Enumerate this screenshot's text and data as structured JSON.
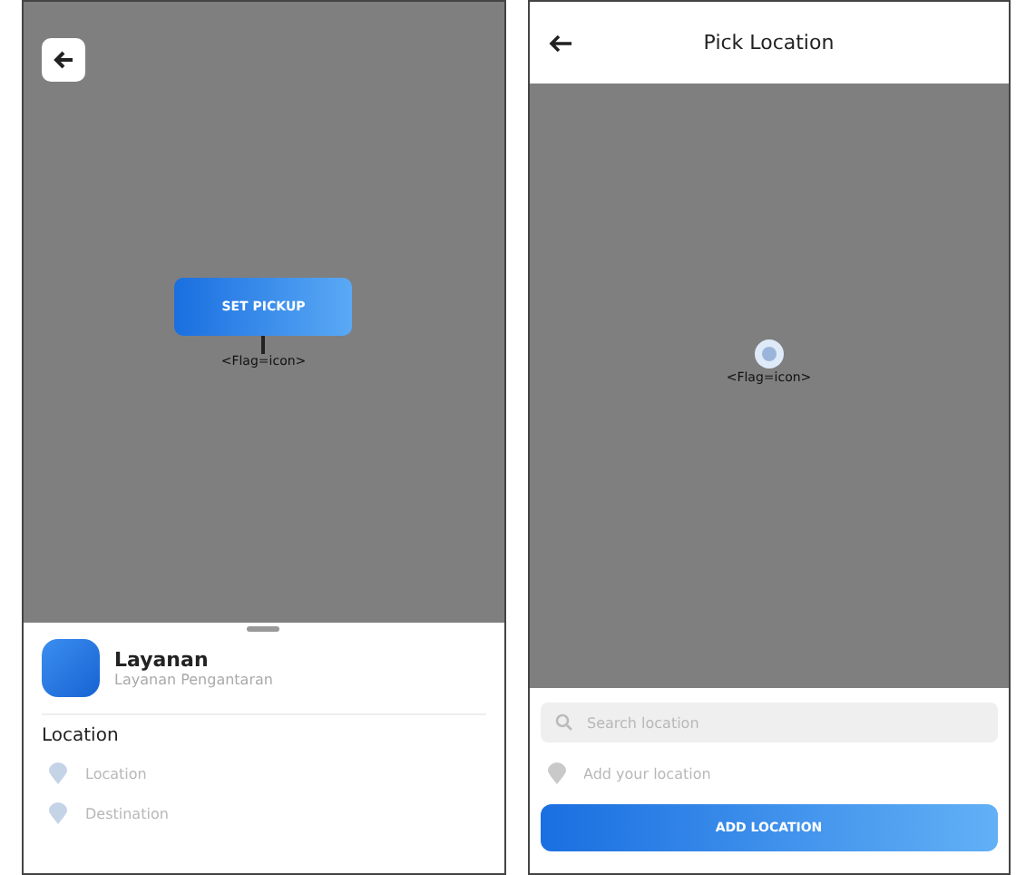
{
  "pickup_screen": {
    "set_pickup_button": "SET PICKUP",
    "marker_label": "<Flag=icon>",
    "service": {
      "title": "Layanan",
      "subtitle": "Layanan Pengantaran"
    },
    "location_heading": "Location",
    "fields": [
      {
        "placeholder": "Location"
      },
      {
        "placeholder": "Destination"
      }
    ]
  },
  "pick_location_screen": {
    "title": "Pick Location",
    "marker_label": "<Flag=icon>",
    "search": {
      "placeholder": "Search location"
    },
    "add_location_placeholder": "Add your location",
    "add_button": "ADD LOCATION"
  }
}
